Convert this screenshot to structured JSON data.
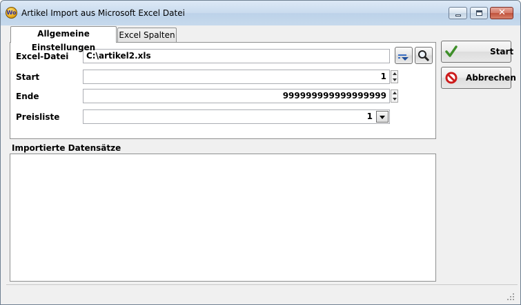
{
  "window": {
    "title": "Artikel Import aus Microsoft Excel Datei",
    "icon": "app-logo-icon",
    "icon_text": "Wo"
  },
  "tabs": [
    {
      "label": "Allgemeine Einstellungen",
      "active": true
    },
    {
      "label": "Excel Spalten",
      "active": false
    }
  ],
  "form": {
    "excel_file": {
      "label": "Excel-Datei",
      "value": "C:\\artikel2.xls"
    },
    "start": {
      "label": "Start",
      "value": "1"
    },
    "end": {
      "label": "Ende",
      "value": "999999999999999999"
    },
    "price_list": {
      "label": "Preisliste",
      "value": "1"
    }
  },
  "imported": {
    "label": "Importierte Datensätze",
    "items": []
  },
  "buttons": {
    "start": {
      "label": "Start",
      "icon": "checkmark-icon"
    },
    "cancel": {
      "label": "Abbrechen",
      "icon": "no-entry-icon"
    },
    "options_icon": "dropdown-options-icon",
    "search_icon": "magnifier-icon"
  },
  "colors": {
    "check": "#3f8f2a",
    "cancel_red": "#cc1b1b",
    "title_gradient": "#c9dbee"
  }
}
